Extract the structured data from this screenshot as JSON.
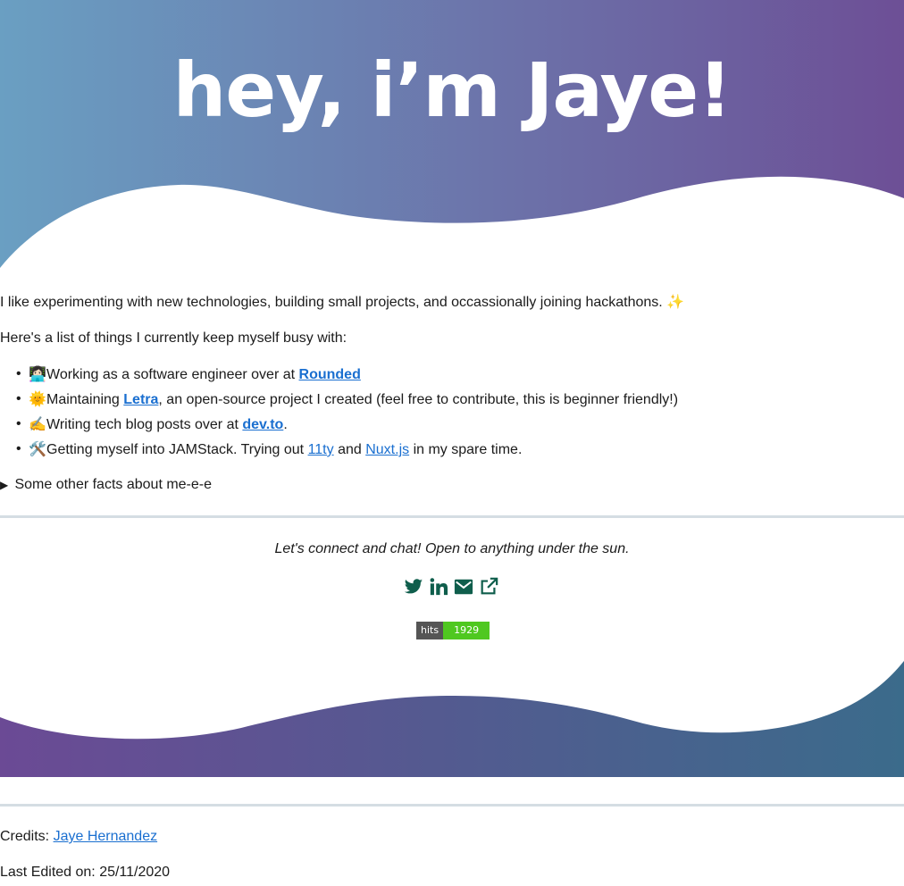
{
  "hero": {
    "title": "hey, i’m Jaye!"
  },
  "intro": "I like experimenting with new technologies, building small projects, and occassionally joining hackathons. ✨",
  "busy_intro": "Here's a list of things I currently keep myself busy with:",
  "activities": [
    {
      "emoji": "👩🏻‍💻",
      "text": "Working as a software engineer over at ",
      "link": "Rounded",
      "after": ""
    },
    {
      "emoji": "🌞",
      "text": "Maintaining ",
      "link": "Letra",
      "after": ", an open-source project I created (feel free to contribute, this is beginner friendly!)"
    },
    {
      "emoji": "✍️",
      "text": "Writing tech blog posts over at ",
      "link": "dev.to",
      "after": "."
    },
    {
      "emoji": "🛠️",
      "text": "Getting myself into JAMStack. Trying out ",
      "link": "11ty",
      "middle": " and ",
      "link2": "Nuxt.js",
      "after": " in my spare time."
    }
  ],
  "details_summary": "Some other facts about me-e-e",
  "connect": "Let's connect and chat! Open to anything under the sun.",
  "socials": [
    {
      "icon": "twitter-icon"
    },
    {
      "icon": "linkedin-icon"
    },
    {
      "icon": "email-icon"
    },
    {
      "icon": "external-link-icon"
    }
  ],
  "hits": {
    "label": "hits",
    "count": "1929"
  },
  "credits": {
    "label": "Credits: ",
    "name": "Jaye Hernandez"
  },
  "last_edited": "Last Edited on: 25/11/2020",
  "colors": {
    "hero_start": "#6a9fc2",
    "hero_end": "#6d4f96",
    "footer_start": "#6b4a95",
    "footer_end": "#3b6b8b",
    "link": "#1a6fd0",
    "icon": "#0f5e4c",
    "hits_green": "#4fc820"
  }
}
